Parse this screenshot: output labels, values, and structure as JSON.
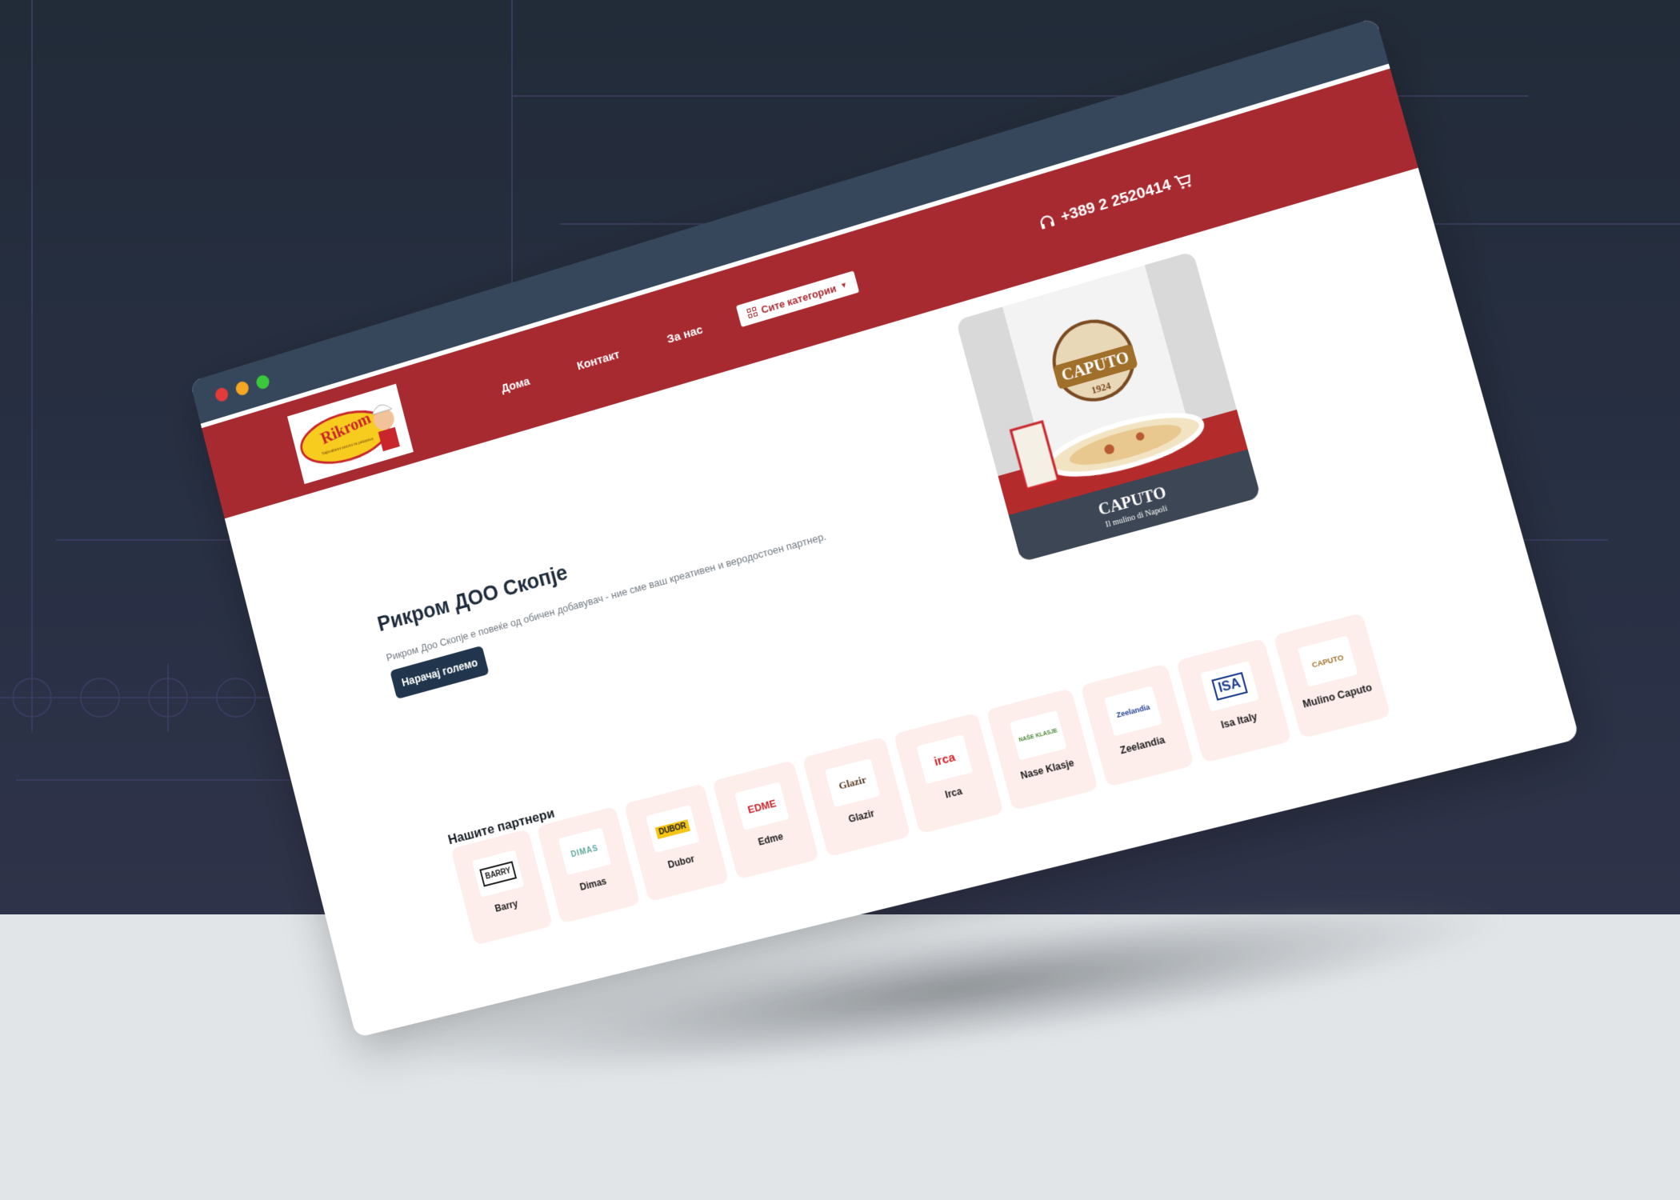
{
  "header": {
    "nav": [
      "Дома",
      "Контакт",
      "За нас"
    ],
    "categories_button": "Сите категории",
    "phone": "+389 2 2520414"
  },
  "logo": {
    "brand": "Rikrom",
    "tagline": "Najkvalitetni sirovini za pekarstvo"
  },
  "hero": {
    "title": "Рикром ДОО Скопје",
    "subtitle": "Рикром Доо Скопје е повеќе од обичен добавувач - ние сме ваш креативен и веродостоен партнер.",
    "button": "Нарачај големо",
    "image_brand": "CAPUTO",
    "image_year": "1924",
    "image_caption": "Il mulino di Napoli"
  },
  "partners": {
    "title": "Нашите партнери",
    "items": [
      {
        "name": "Barry",
        "logo_text": "BARRY",
        "logo_color": "#1c1c1c"
      },
      {
        "name": "Dimas",
        "logo_text": "DIMAS",
        "logo_color": "#5aa79a"
      },
      {
        "name": "Dubor",
        "logo_text": "DUBOR",
        "logo_color": "#1a1a1a"
      },
      {
        "name": "Edme",
        "logo_text": "EDME",
        "logo_color": "#c8262c"
      },
      {
        "name": "Glazir",
        "logo_text": "Glazir",
        "logo_color": "#5a3a22"
      },
      {
        "name": "Irca",
        "logo_text": "irca",
        "logo_color": "#d2232a"
      },
      {
        "name": "Nase Klasje",
        "logo_text": "NAŠE KLASJE",
        "logo_color": "#4b8a3a"
      },
      {
        "name": "Zeelandia",
        "logo_text": "Zeelandia",
        "logo_color": "#1f3f8e"
      },
      {
        "name": "Isa Italy",
        "logo_text": "ISA",
        "logo_color": "#1b3c8c"
      },
      {
        "name": "Mulino Caputo",
        "logo_text": "CAPUTO",
        "logo_color": "#a0702a"
      }
    ]
  },
  "colors": {
    "brand_red": "#a62a30",
    "dark_navy": "#21364c",
    "card_bg": "#fdeeec",
    "chrome": "#37475b"
  }
}
